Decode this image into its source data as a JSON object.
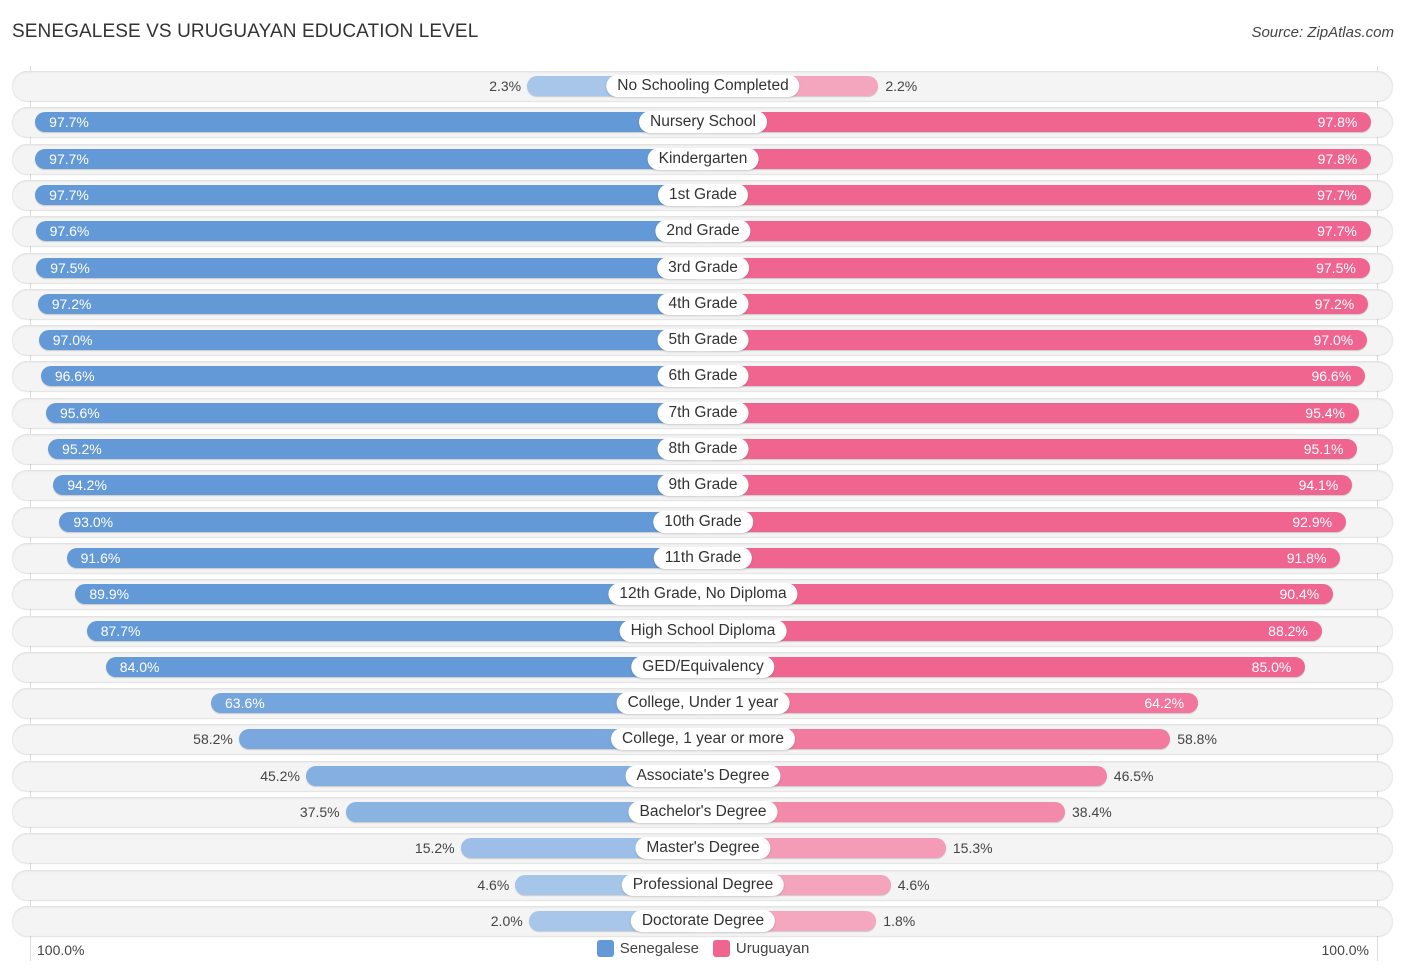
{
  "header": {
    "title": "SENEGALESE VS URUGUAYAN EDUCATION LEVEL",
    "source": "Source: ZipAtlas.com"
  },
  "colors": {
    "senegalese": "#6499d8",
    "senegalese_light": "#a9c7ea",
    "uruguayan": "#f06590",
    "uruguayan_light": "#f5a8c0"
  },
  "axis": {
    "left_label": "100.0%",
    "right_label": "100.0%"
  },
  "legend": {
    "items": [
      {
        "name": "Senegalese",
        "color": "#6499d8"
      },
      {
        "name": "Uruguayan",
        "color": "#f06590"
      }
    ]
  },
  "chart_data": {
    "type": "bar",
    "orientation": "horizontal-diverging",
    "title": "SENEGALESE VS URUGUAYAN EDUCATION LEVEL",
    "xlabel": "",
    "ylabel": "",
    "xlim": [
      0,
      100
    ],
    "unit": "%",
    "legend_position": "bottom-center",
    "categories": [
      "No Schooling Completed",
      "Nursery School",
      "Kindergarten",
      "1st Grade",
      "2nd Grade",
      "3rd Grade",
      "4th Grade",
      "5th Grade",
      "6th Grade",
      "7th Grade",
      "8th Grade",
      "9th Grade",
      "10th Grade",
      "11th Grade",
      "12th Grade, No Diploma",
      "High School Diploma",
      "GED/Equivalency",
      "College, Under 1 year",
      "College, 1 year or more",
      "Associate's Degree",
      "Bachelor's Degree",
      "Master's Degree",
      "Professional Degree",
      "Doctorate Degree"
    ],
    "series": [
      {
        "name": "Senegalese",
        "side": "left",
        "values": [
          2.3,
          97.7,
          97.7,
          97.7,
          97.6,
          97.5,
          97.2,
          97.0,
          96.6,
          95.6,
          95.2,
          94.2,
          93.0,
          91.6,
          89.9,
          87.7,
          84.0,
          63.6,
          58.2,
          45.2,
          37.5,
          15.2,
          4.6,
          2.0
        ],
        "labels": [
          "2.3%",
          "97.7%",
          "97.7%",
          "97.7%",
          "97.6%",
          "97.5%",
          "97.2%",
          "97.0%",
          "96.6%",
          "95.6%",
          "95.2%",
          "94.2%",
          "93.0%",
          "91.6%",
          "89.9%",
          "87.7%",
          "84.0%",
          "63.6%",
          "58.2%",
          "45.2%",
          "37.5%",
          "15.2%",
          "4.6%",
          "2.0%"
        ]
      },
      {
        "name": "Uruguayan",
        "side": "right",
        "values": [
          2.2,
          97.8,
          97.8,
          97.7,
          97.7,
          97.5,
          97.2,
          97.0,
          96.6,
          95.4,
          95.1,
          94.1,
          92.9,
          91.8,
          90.4,
          88.2,
          85.0,
          64.2,
          58.8,
          46.5,
          38.4,
          15.3,
          4.6,
          1.8
        ],
        "labels": [
          "2.2%",
          "97.8%",
          "97.8%",
          "97.7%",
          "97.7%",
          "97.5%",
          "97.2%",
          "97.0%",
          "96.6%",
          "95.4%",
          "95.1%",
          "94.1%",
          "92.9%",
          "91.8%",
          "90.4%",
          "88.2%",
          "85.0%",
          "64.2%",
          "58.8%",
          "46.5%",
          "38.4%",
          "15.3%",
          "4.6%",
          "1.8%"
        ]
      }
    ]
  }
}
